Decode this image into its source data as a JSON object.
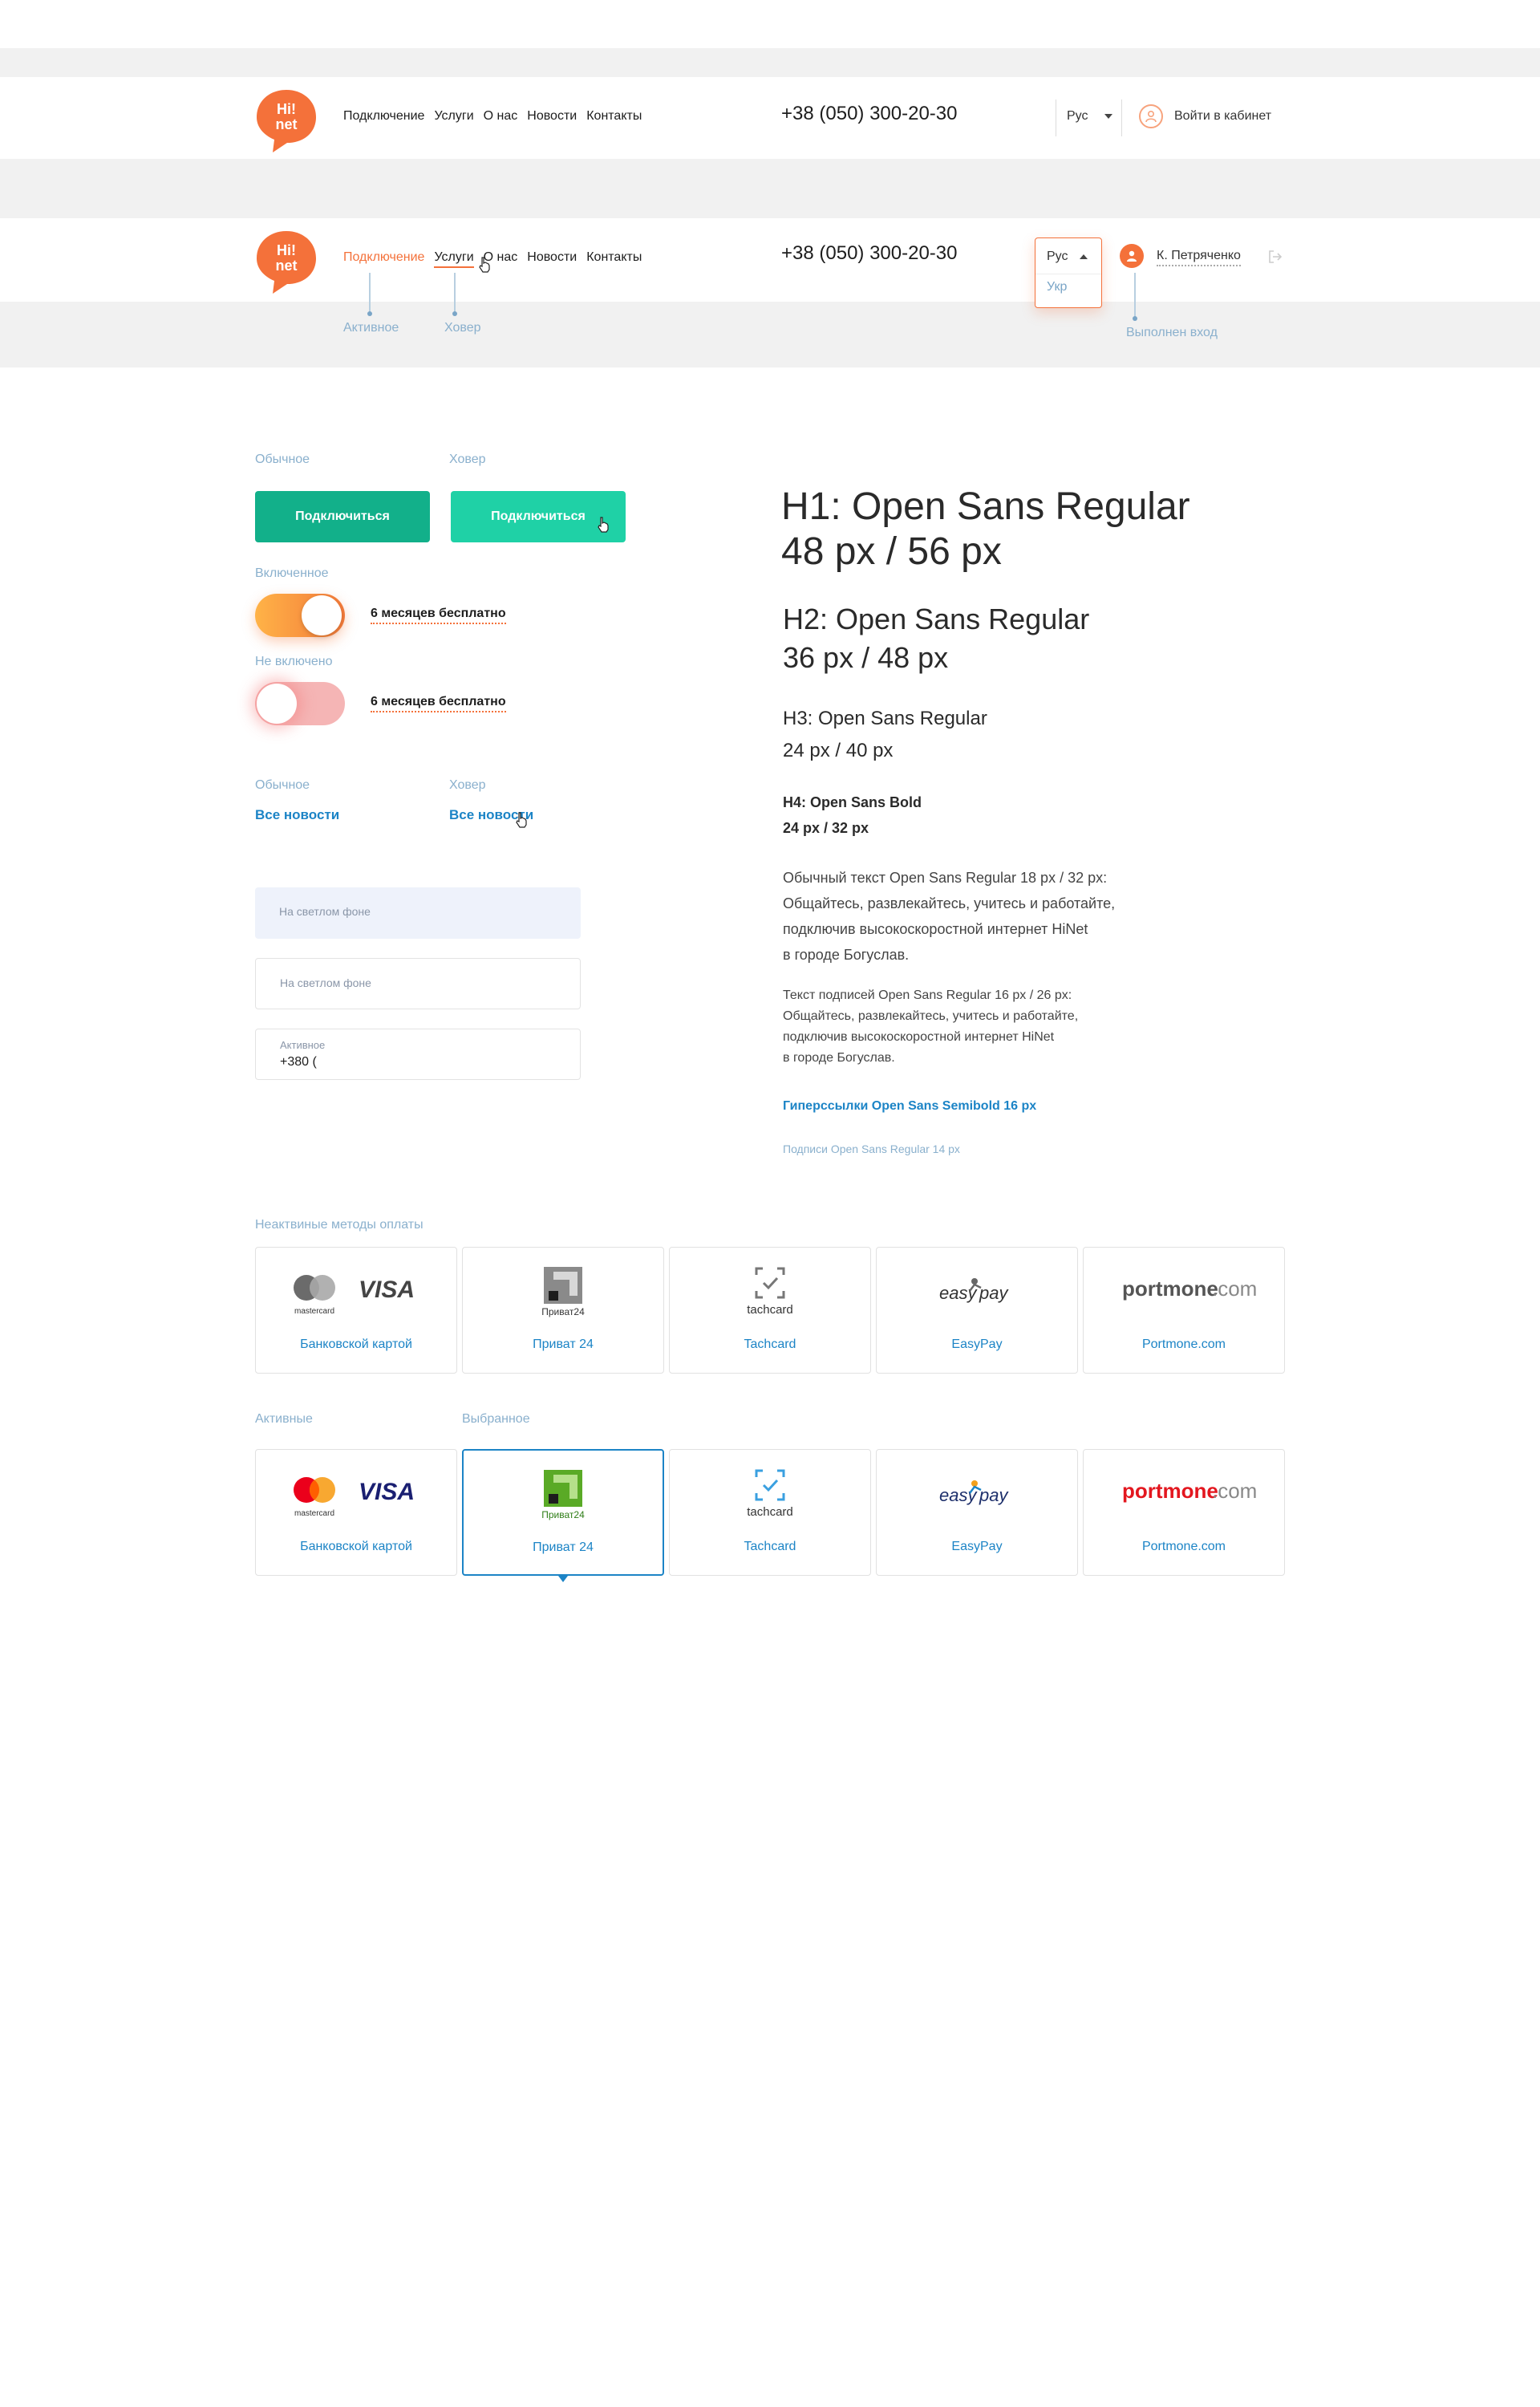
{
  "header_normal": {
    "nav": [
      "Подключение",
      "Услуги",
      "О нас",
      "Новости",
      "Контакты"
    ],
    "phone": "+38 (050) 300-20-30",
    "lang": "Рус",
    "login": "Войти в кабинет"
  },
  "header_state": {
    "nav": [
      "Подключение",
      "Услуги",
      "О нас",
      "Новости",
      "Контакты"
    ],
    "phone": "+38 (050) 300-20-30",
    "lang_selected": "Рус",
    "lang_option": "Укр",
    "user_name": "К. Петряченко",
    "anno_active": "Активное",
    "anno_hover": "Ховер",
    "anno_logged": "Выполнен вход"
  },
  "logo": {
    "line1": "Hi!",
    "line2": "net"
  },
  "buttons": {
    "label_normal": "Обычное",
    "label_hover": "Ховер",
    "text": "Подключиться"
  },
  "toggles": {
    "label_on": "Включенное",
    "label_off": "Не включено",
    "text": "6 месяцев бесплатно"
  },
  "links": {
    "label_normal": "Обычное",
    "label_hover": "Ховер",
    "text": "Все новости"
  },
  "inputs": {
    "placeholder_filled": "На светлом фоне",
    "placeholder_outlined": "На светлом фоне",
    "active_label": "Активное",
    "active_value": "+380 ("
  },
  "typography": {
    "h1_line1": "H1: Open Sans Regular",
    "h1_line2": "48 px / 56 px",
    "h2_line1": "H2: Open Sans Regular",
    "h2_line2": "36 px / 48 px",
    "h3_line1": "H3: Open Sans Regular",
    "h3_line2": "24 px / 40 px",
    "h4_line1": "H4: Open Sans Bold",
    "h4_line2": "24 px / 32 px",
    "body_lines": [
      "Обычный текст Open Sans Regular 18 px / 32 px:",
      "Общайтесь, развлекайтесь, учитесь и работайте,",
      "подключив высокоскоростной интернет HiNet",
      "в городе Богуслав."
    ],
    "caption_lines": [
      "Текст подписей Open Sans Regular 16 px / 26 px:",
      "Общайтесь, развлекайтесь, учитесь и работайте,",
      "подключив высокоскоростной интернет HiNet",
      "в городе Богуслав."
    ],
    "hyperlink": "Гиперссылки Open Sans Semibold 16 px",
    "subcaption": "Подписи Open Sans Regular 14 px"
  },
  "payments": {
    "inactive_title": "Неактвиные методы оплаты",
    "active_title": "Активные",
    "selected_title": "Выбранное",
    "methods": [
      "Банковской картой",
      "Приват 24",
      "Tachcard",
      "EasyPay",
      "Portmone.com"
    ],
    "logo_texts": {
      "mastercard": "mastercard",
      "visa": "VISA",
      "privat": "Приват24",
      "tachcard": "tachcard",
      "easy": "easy",
      "pay": "pay",
      "portmone": "portmone",
      "portmone_com": ".com"
    }
  },
  "colors": {
    "brand_orange": "#f4713a",
    "green_button": "#12b08a",
    "green_button_hover": "#1fd1a6",
    "link_blue": "#1c84c6",
    "annotation": "#8ab0cd",
    "band_gray": "#f1f1f1"
  }
}
